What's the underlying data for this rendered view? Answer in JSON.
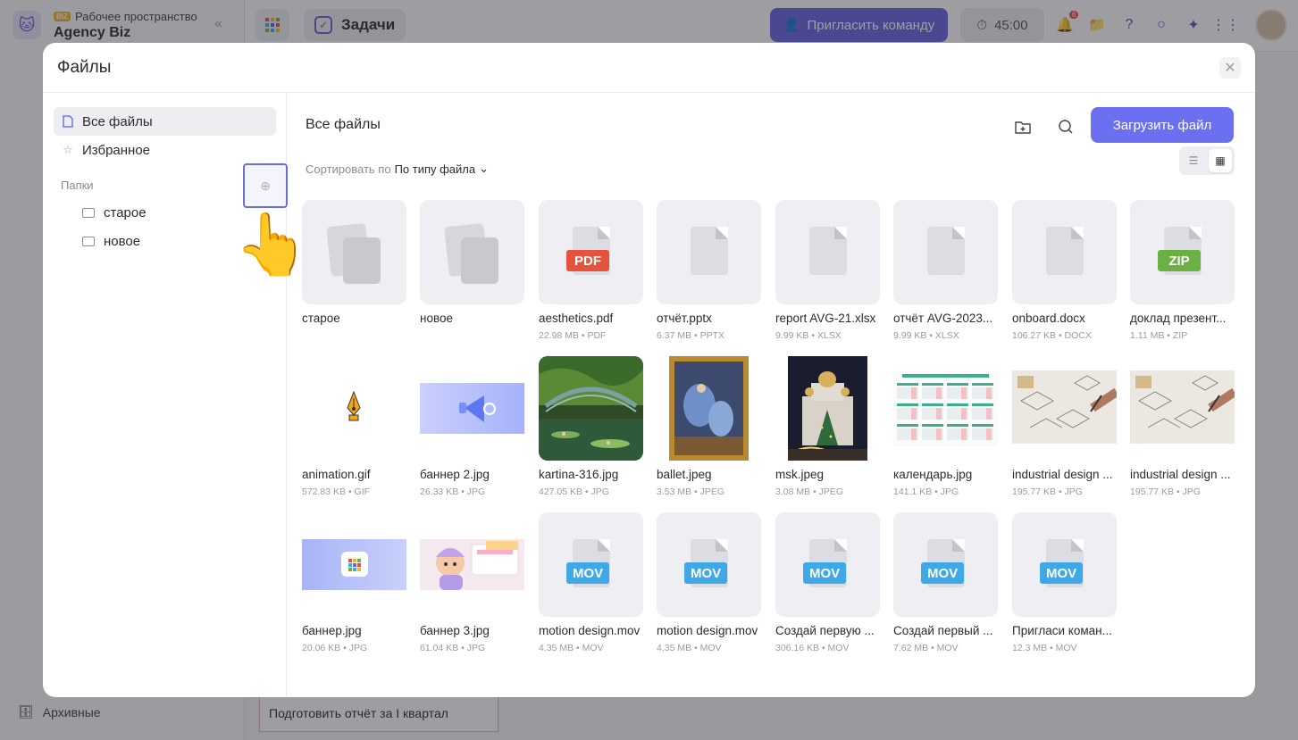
{
  "background": {
    "workspace_badge": "BIZ",
    "workspace_caption": "Рабочее пространство",
    "workspace_name": "Agency Biz",
    "tab_title": "Задачи",
    "invite_label": "Пригласить команду",
    "timer": "45:00",
    "notification_count": "6",
    "archive_label": "Архивные",
    "bottom_task": "Подготовить отчёт за I квартал"
  },
  "modal": {
    "title": "Файлы",
    "nav": {
      "all_files": "Все файлы",
      "favorites": "Избранное",
      "folders_label": "Папки",
      "folders": [
        "старое",
        "новое"
      ]
    },
    "main": {
      "title": "Все файлы",
      "upload_label": "Загрузить файл",
      "sort_prefix": "Сортировать по",
      "sort_value": "По типу файла"
    },
    "files": [
      {
        "name": "старое",
        "meta": "",
        "kind": "folder"
      },
      {
        "name": "новое",
        "meta": "",
        "kind": "folder"
      },
      {
        "name": "aesthetics.pdf",
        "meta": "22.98 MB • PDF",
        "kind": "doc",
        "tag": "PDF",
        "tag_color": "#e5533d"
      },
      {
        "name": "отчёт.pptx",
        "meta": "6.37 MB • PPTX",
        "kind": "doc"
      },
      {
        "name": "report AVG-21.xlsx",
        "meta": "9.99 KB • XLSX",
        "kind": "doc"
      },
      {
        "name": "отчёт AVG-2023...",
        "meta": "9.99 KB • XLSX",
        "kind": "doc"
      },
      {
        "name": "onboard.docx",
        "meta": "106.27 KB • DOCX",
        "kind": "doc"
      },
      {
        "name": "доклад презент...",
        "meta": "1.11 MB • ZIP",
        "kind": "doc",
        "tag": "ZIP",
        "tag_color": "#6cb043"
      },
      {
        "name": "animation.gif",
        "meta": "572.83 KB • GIF",
        "kind": "gif"
      },
      {
        "name": "баннер 2.jpg",
        "meta": "26.33 KB • JPG",
        "kind": "banner2"
      },
      {
        "name": "kartina-316.jpg",
        "meta": "427.05 KB • JPG",
        "kind": "monet"
      },
      {
        "name": "ballet.jpeg",
        "meta": "3.53 MB • JPEG",
        "kind": "ballet"
      },
      {
        "name": "msk.jpeg",
        "meta": "3.08 MB • JPEG",
        "kind": "msk"
      },
      {
        "name": "календарь.jpg",
        "meta": "141.1 KB • JPG",
        "kind": "calendar"
      },
      {
        "name": "industrial design ...",
        "meta": "195.77 KB • JPG",
        "kind": "sketch"
      },
      {
        "name": "industrial design ...",
        "meta": "195.77 KB • JPG",
        "kind": "sketch"
      },
      {
        "name": "баннер.jpg",
        "meta": "20.06 KB • JPG",
        "kind": "banner"
      },
      {
        "name": "баннер 3.jpg",
        "meta": "61.04 KB • JPG",
        "kind": "banner3"
      },
      {
        "name": "motion design.mov",
        "meta": "4.35 MB • MOV",
        "kind": "doc",
        "tag": "MOV",
        "tag_color": "#3fa9e8"
      },
      {
        "name": "motion design.mov",
        "meta": "4.35 MB • MOV",
        "kind": "doc",
        "tag": "MOV",
        "tag_color": "#3fa9e8"
      },
      {
        "name": "Создай первую ...",
        "meta": "306.16 KB • MOV",
        "kind": "doc",
        "tag": "MOV",
        "tag_color": "#3fa9e8"
      },
      {
        "name": "Создай первый ...",
        "meta": "7.62 MB • MOV",
        "kind": "doc",
        "tag": "MOV",
        "tag_color": "#3fa9e8"
      },
      {
        "name": "Пригласи коман...",
        "meta": "12.3 MB • MOV",
        "kind": "doc",
        "tag": "MOV",
        "tag_color": "#3fa9e8"
      }
    ]
  }
}
